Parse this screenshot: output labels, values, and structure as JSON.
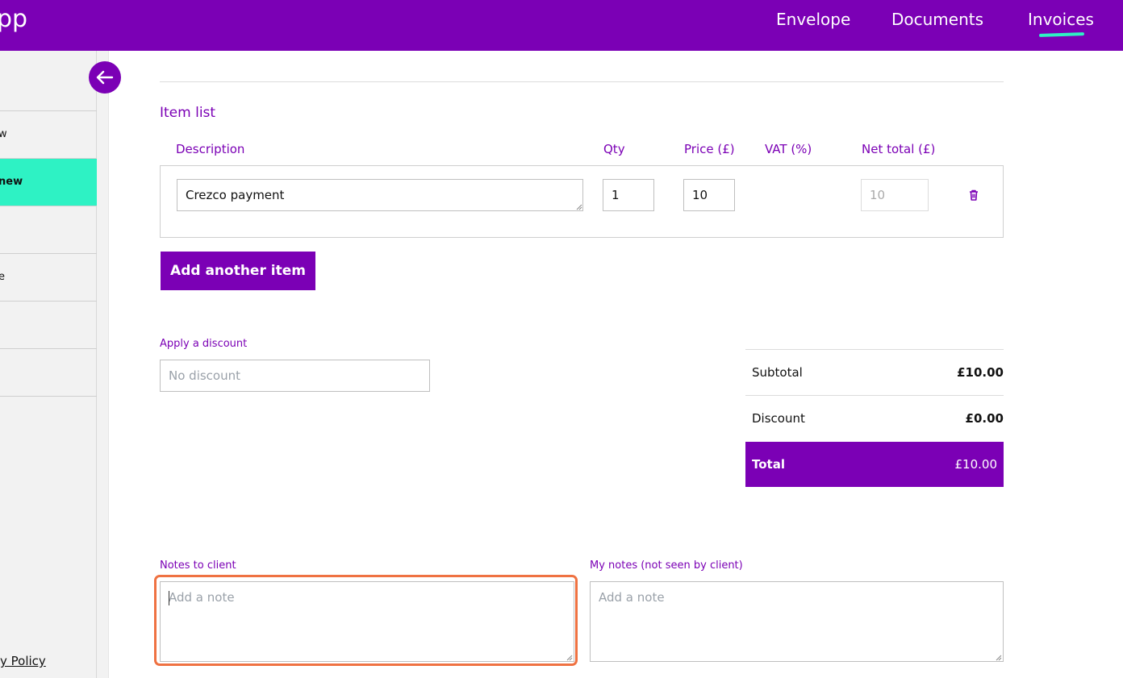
{
  "app": {
    "logo_text": "pp"
  },
  "nav": {
    "items": [
      "Envelope",
      "Documents",
      "Invoices"
    ],
    "active": "Invoices"
  },
  "sidebar": {
    "items": [
      {
        "label": "w",
        "active": false
      },
      {
        "label": "new",
        "active": true
      },
      {
        "label": "",
        "active": false
      },
      {
        "label": "e",
        "active": false
      },
      {
        "label": "",
        "active": false
      },
      {
        "label": "",
        "active": false
      }
    ],
    "footer_link": "y Policy"
  },
  "item_list": {
    "title": "Item list",
    "columns": [
      "Description",
      "Qty",
      "Price (£)",
      "VAT (%)",
      "Net total (£)"
    ],
    "rows": [
      {
        "description": "Crezco payment",
        "qty": "1",
        "price": "10",
        "vat": "",
        "net_total": "10"
      }
    ],
    "add_button": "Add another item"
  },
  "discount": {
    "label": "Apply a discount",
    "placeholder": "No discount"
  },
  "summary": {
    "subtotal_label": "Subtotal",
    "subtotal_value": "£10.00",
    "discount_label": "Discount",
    "discount_value": "£0.00",
    "total_label": "Total",
    "total_value": "£10.00"
  },
  "notes": {
    "client_label": "Notes to client",
    "client_placeholder": "Add a note",
    "private_label": "My notes (not seen by client)",
    "private_placeholder": "Add a note"
  },
  "colors": {
    "brand": "#7b00b5",
    "accent": "#2ef2c4",
    "focus": "#ef7242"
  }
}
